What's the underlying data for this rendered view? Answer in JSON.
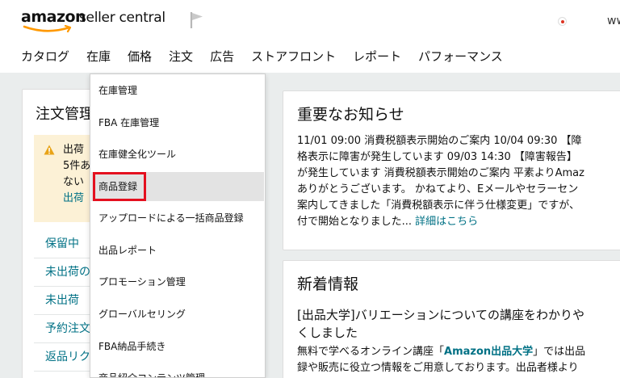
{
  "header": {
    "logo_amazon": "amazon",
    "logo_product": "seller central",
    "domain": "www.a"
  },
  "nav": {
    "items": [
      "カタログ",
      "在庫",
      "価格",
      "注文",
      "広告",
      "ストアフロント",
      "レポート",
      "パフォーマンス"
    ]
  },
  "dropdown": {
    "items": [
      "在庫管理",
      "FBA 在庫管理",
      "在庫健全化ツール",
      "商品登録",
      "アップロードによる一括商品登録",
      "出品レポート",
      "プロモーション管理",
      "グローバルセリング",
      "FBA納品手続き",
      "商品紹介コンテンツ管理"
    ]
  },
  "left_panel": {
    "title": "注文管理",
    "alert_lines": [
      "出荷",
      "5件あ",
      "ない",
      "出荷"
    ],
    "links": [
      "保留中",
      "未出荷の",
      "未出荷",
      "予約注文",
      "返品リク"
    ]
  },
  "important_notice": {
    "title": "重要なお知らせ",
    "lines": [
      "11/01 09:00  消費税額表示開始のご案内   10/04 09:30  【障",
      "格表示に障害が発生しています 09/03 14:30 【障害報告】",
      "が発生しています 消費税額表示開始のご案内 平素よりAmaz",
      "ありがとうございます。 かねてより、Eメールやセラーセン",
      "案内してきました「消費税額表示に伴う仕様変更」ですが、",
      "付で開始となりました..."
    ],
    "more_link": "詳細はこちら"
  },
  "news": {
    "title": "新着情報",
    "headline_line1": "[出品大学]バリエーションについての講座をわかりや",
    "headline_line2": "くしました",
    "body_pre": " 無料で学べるオンライン講座「",
    "body_bold": "Amazon出品大学",
    "body_post": "」では出品",
    "body_line2": "録や販売に役立つ情報をご用意しております。出品者様より"
  },
  "colors": {
    "link": "#007185",
    "alert_bg": "#fcf1d6",
    "highlight_border": "#e4101f",
    "page_bg": "#eaeded"
  },
  "icons": [
    "amazon-smile-icon",
    "flag-icon",
    "japan-flag-icon",
    "warning-icon"
  ]
}
